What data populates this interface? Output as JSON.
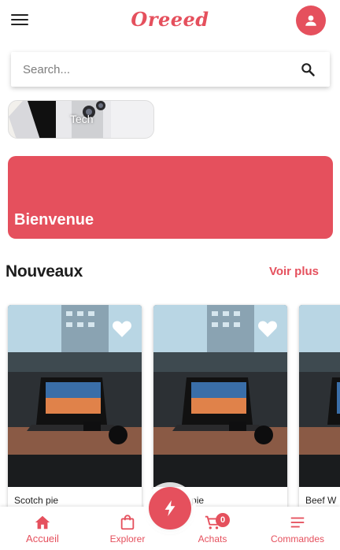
{
  "header": {
    "logo": "Oreeed",
    "menu_icon": "hamburger-menu-icon",
    "profile_icon": "user-icon"
  },
  "search": {
    "placeholder": "Search...",
    "icon": "search-icon"
  },
  "category": {
    "label": "Tech"
  },
  "banner": {
    "text": "Bienvenue"
  },
  "section": {
    "title": "Nouveaux",
    "see_more": "Voir plus"
  },
  "products": [
    {
      "name": "Scotch pie"
    },
    {
      "name": "Scotch pie"
    },
    {
      "name": "Beef W"
    }
  ],
  "bottom_nav": {
    "items": [
      {
        "label": "Accueil",
        "icon": "home-icon"
      },
      {
        "label": "Explorer",
        "icon": "shopping-bag-icon"
      },
      {
        "label": "Achats",
        "icon": "cart-icon"
      },
      {
        "label": "Commandes",
        "icon": "list-icon"
      }
    ],
    "cart_count": "0",
    "fab_icon": "lightning-icon"
  },
  "colors": {
    "accent": "#e5505d"
  }
}
